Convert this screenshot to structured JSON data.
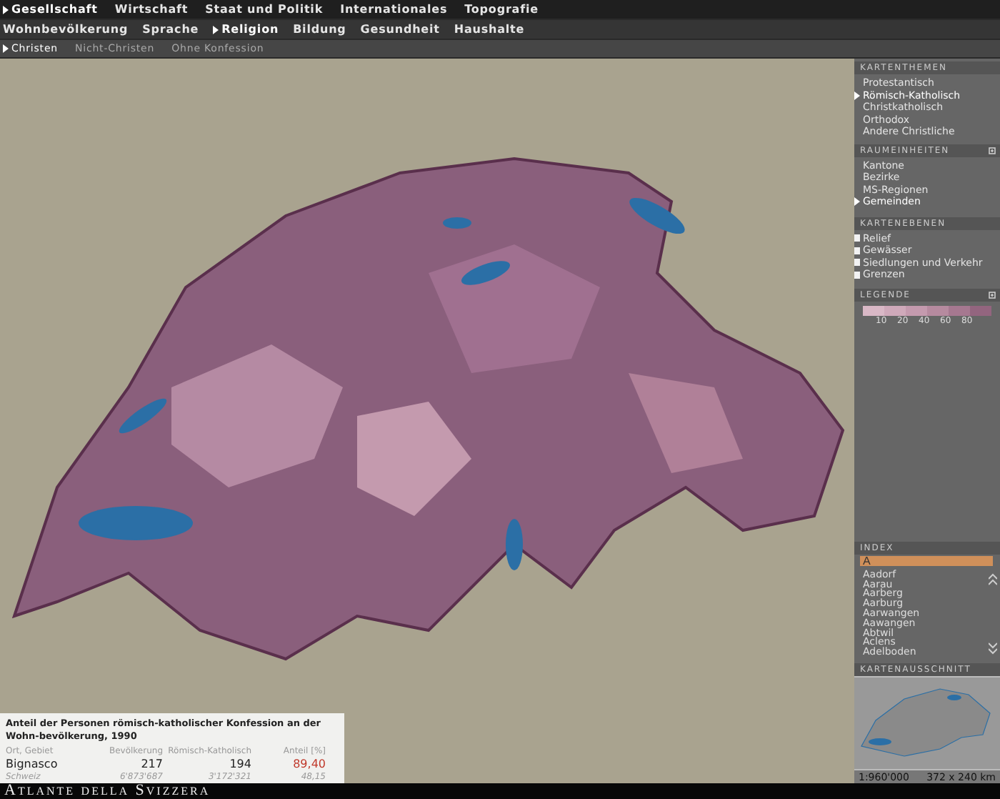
{
  "nav_level_1": [
    {
      "label": "Gesellschaft",
      "selected": true
    },
    {
      "label": "Wirtschaft",
      "selected": false
    },
    {
      "label": "Staat und Politik",
      "selected": false
    },
    {
      "label": "Internationales",
      "selected": false
    },
    {
      "label": "Topografie",
      "selected": false
    }
  ],
  "nav_level_2": [
    {
      "label": "Wohnbevölkerung",
      "selected": false
    },
    {
      "label": "Sprache",
      "selected": false
    },
    {
      "label": "Religion",
      "selected": true
    },
    {
      "label": "Bildung",
      "selected": false
    },
    {
      "label": "Gesundheit",
      "selected": false
    },
    {
      "label": "Haushalte",
      "selected": false
    }
  ],
  "nav_level_3": [
    {
      "label": "Christen",
      "selected": true
    },
    {
      "label": "Nicht-Christen",
      "selected": false
    },
    {
      "label": "Ohne Konfession",
      "selected": false
    }
  ],
  "info_panel": {
    "title": "Anteil der Personen römisch-katholischer Konfession an der Wohn-bevölkerung, 1990",
    "columns": [
      "Ort, Gebiet",
      "Bevölkerung",
      "Römisch-Katholisch",
      "Anteil [%]"
    ],
    "rows": [
      {
        "kind": "selected",
        "cells": [
          "Bignasco",
          "217",
          "194",
          "89,40"
        ]
      },
      {
        "kind": "total",
        "cells": [
          "Schweiz",
          "6'873'687",
          "3'172'321",
          "48,15"
        ]
      }
    ]
  },
  "footer": {
    "title": "Atlante della Svizzera"
  },
  "sidebar": {
    "kartenthemen": {
      "title": "KARTENTHEMEN",
      "items": [
        {
          "label": "Protestantisch",
          "selected": false
        },
        {
          "label": "Römisch-Katholisch",
          "selected": true
        },
        {
          "label": "Christkatholisch",
          "selected": false
        },
        {
          "label": "Orthodox",
          "selected": false
        },
        {
          "label": "Andere Christliche",
          "selected": false
        }
      ]
    },
    "raumeinheiten": {
      "title": "RAUMEINHEITEN",
      "items": [
        {
          "label": "Kantone",
          "selected": false
        },
        {
          "label": "Bezirke",
          "selected": false
        },
        {
          "label": "MS-Regionen",
          "selected": false
        },
        {
          "label": "Gemeinden",
          "selected": true
        }
      ]
    },
    "kartenebenen": {
      "title": "KARTENEBENEN",
      "items": [
        {
          "label": "Relief",
          "checked": true
        },
        {
          "label": "Gewässer",
          "checked": true
        },
        {
          "label": "Siedlungen und Verkehr",
          "checked": true
        },
        {
          "label": "Grenzen",
          "checked": true
        }
      ]
    },
    "legende": {
      "title": "LEGENDE",
      "swatches": [
        {
          "color": "#d9b8c6"
        },
        {
          "color": "#cfa9ba"
        },
        {
          "color": "#c49aae"
        },
        {
          "color": "#b68a9f"
        },
        {
          "color": "#a67890"
        },
        {
          "color": "#93657f"
        }
      ],
      "ticks": [
        "10",
        "20",
        "40",
        "60",
        "80"
      ]
    },
    "index": {
      "title": "INDEX",
      "value": "A",
      "items": [
        "Aadorf",
        "Aarau",
        "Aarberg",
        "Aarburg",
        "Aarwangen",
        "Aawangen",
        "Abtwil",
        "Aclens",
        "Adelboden"
      ]
    },
    "kartenausschnitt": {
      "title": "KARTENAUSSCHNITT",
      "scale": "1:960'000",
      "size": "372 x 240 km"
    }
  }
}
